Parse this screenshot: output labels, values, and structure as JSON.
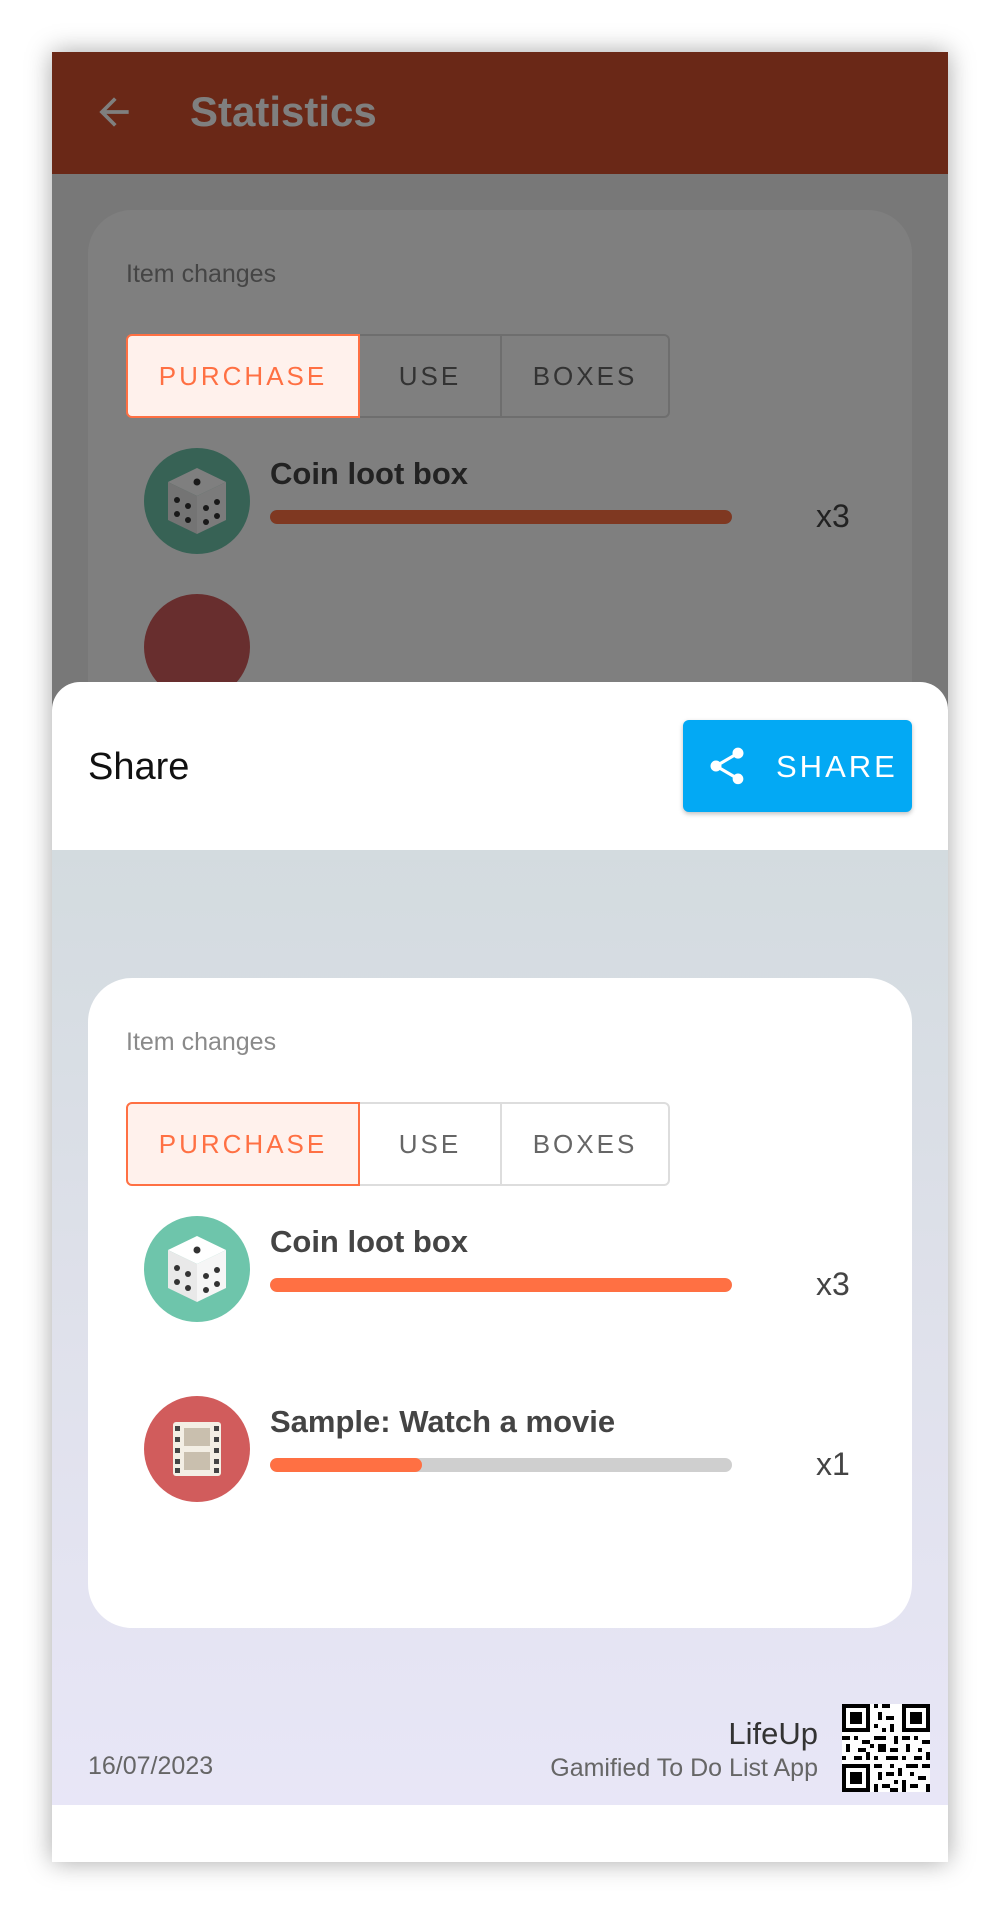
{
  "appbar": {
    "title": "Statistics",
    "back_icon": "arrow-back-icon"
  },
  "card": {
    "label": "Item changes",
    "tabs": [
      {
        "label": "PURCHASE",
        "selected": true
      },
      {
        "label": "USE",
        "selected": false
      },
      {
        "label": "BOXES",
        "selected": false
      }
    ],
    "items": [
      {
        "name": "Coin loot box",
        "count": "x3",
        "progress": 1.0,
        "icon": "dice-icon",
        "icon_color": "#6ec5ab"
      },
      {
        "name": "Sample: Watch a movie",
        "count": "x1",
        "progress": 0.33,
        "icon": "film-icon",
        "icon_color": "#d15c5c"
      }
    ]
  },
  "sheet": {
    "title": "Share",
    "share_button": "SHARE",
    "share_icon": "share-icon"
  },
  "footer": {
    "date": "16/07/2023",
    "app_name": "LifeUp",
    "tagline": "Gamified To Do List App",
    "qr_icon": "qr-code-icon"
  },
  "colors": {
    "appbar": "#d4502f",
    "accent": "#ff7043",
    "share_button": "#03a9f4"
  }
}
